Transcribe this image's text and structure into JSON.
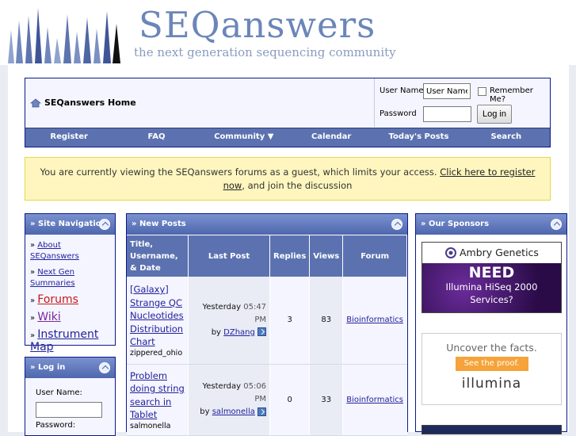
{
  "header": {
    "title": "SEQanswers",
    "tagline": "the next generation sequencing community"
  },
  "topbar": {
    "home_label": "SEQanswers Home",
    "login": {
      "username_label": "User Name",
      "username_value": "User Name",
      "remember_label": "Remember Me?",
      "password_label": "Password",
      "login_button": "Log in"
    },
    "nav": [
      "Register",
      "FAQ",
      "Community ▼",
      "Calendar",
      "Today's Posts",
      "Search"
    ]
  },
  "notice": {
    "text_before": "You are currently viewing the SEQanswers forums as a guest, which limits your access.",
    "link": "Click here to register now",
    "text_after": ", and join the discussion"
  },
  "site_nav": {
    "title": "» Site Navigation",
    "items": [
      "About SEQanswers",
      "Next Gen Summaries",
      "Forums",
      "Wiki",
      "Instrument Map"
    ]
  },
  "login_panel": {
    "title": "» Log in",
    "username_label": "User Name:",
    "password_label": "Password:"
  },
  "new_posts": {
    "title": "» New Posts",
    "headers": [
      "Title, Username, & Date",
      "Last Post",
      "Replies",
      "Views",
      "Forum"
    ],
    "rows": [
      {
        "title": "[Galaxy] Strange QC Nucleotides Distribution Chart",
        "starter": "zippered_ohio",
        "last_day": "Yesterday",
        "last_time": "05:47 PM",
        "by": "by",
        "last_user": "DZhang",
        "replies": "3",
        "views": "83",
        "forum": "Bioinformatics"
      },
      {
        "title": "Problem doing string search in Tablet",
        "starter": "salmonella",
        "last_day": "Yesterday",
        "last_time": "05:06 PM",
        "by": "by",
        "last_user": "salmonella",
        "replies": "0",
        "views": "33",
        "forum": "Bioinformatics"
      }
    ]
  },
  "sponsors": {
    "title": "» Our Sponsors",
    "ambry": {
      "brand": "Ambry Genetics",
      "line1": "NEED",
      "line2": "Illumina HiSeq 2000",
      "line3": "Services?"
    },
    "illumina": {
      "headline": "Uncover the facts.",
      "button": "See the proof.",
      "brand": "illumina"
    }
  },
  "colors": {
    "nav_blue": "#5c72b0",
    "border_blue": "#0b198c",
    "notice_yellow": "#fff6bf",
    "link_blue": "#22229c",
    "illumina_orange": "#f5a33a"
  }
}
